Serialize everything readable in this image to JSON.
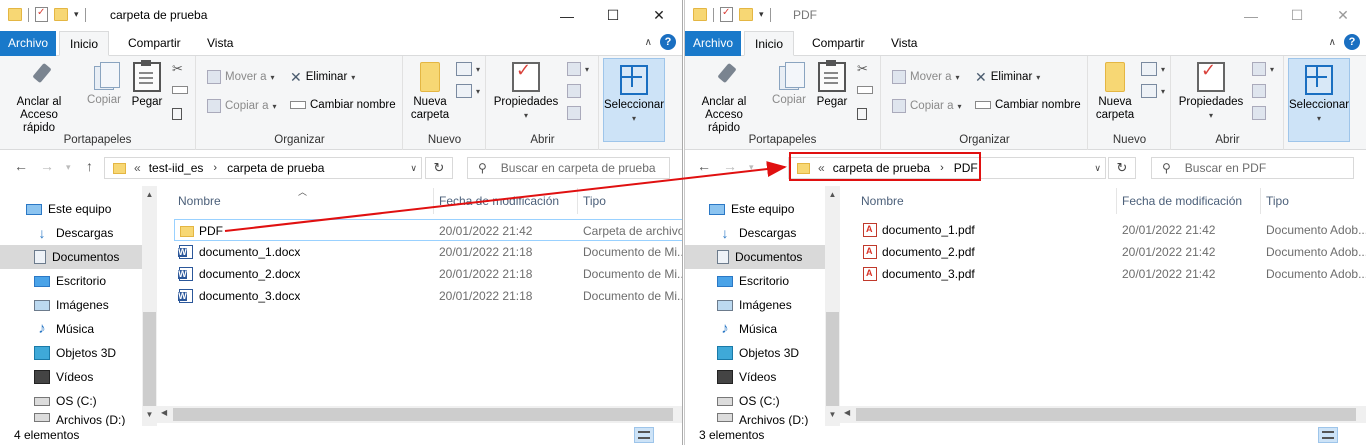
{
  "windows": [
    {
      "id": "left",
      "title": "carpeta de prueba",
      "tabs": {
        "file": "Archivo",
        "home": "Inicio",
        "share": "Compartir",
        "view": "Vista"
      },
      "ribbon": {
        "clipboard": {
          "label": "Portapapeles",
          "pin": "Anclar al\nAcceso rápido",
          "copy": "Copiar",
          "paste": "Pegar"
        },
        "organize": {
          "label": "Organizar",
          "move": "Mover a",
          "copy_to": "Copiar a",
          "delete": "Eliminar",
          "rename": "Cambiar nombre"
        },
        "new": {
          "label": "Nuevo",
          "new_folder": "Nueva\ncarpeta"
        },
        "open": {
          "label": "Abrir",
          "properties": "Propiedades"
        },
        "select": {
          "label": "Seleccionar"
        }
      },
      "address": {
        "overflow": "«",
        "crumbs": [
          "test-iid_es",
          "carpeta de prueba"
        ]
      },
      "search_placeholder": "Buscar en carpeta de prueba",
      "nav": [
        "Este equipo",
        "Descargas",
        "Documentos",
        "Escritorio",
        "Imágenes",
        "Música",
        "Objetos 3D",
        "Vídeos",
        "OS (C:)",
        "Archivos (D:)"
      ],
      "nav_selected": "Documentos",
      "columns": {
        "name": "Nombre",
        "date": "Fecha de modificación",
        "type": "Tipo"
      },
      "files": [
        {
          "name": "PDF",
          "date": "20/01/2022 21:42",
          "type": "Carpeta de archivos",
          "icon": "folder-icon"
        },
        {
          "name": "documento_1.docx",
          "date": "20/01/2022 21:18",
          "type": "Documento de Mi...",
          "icon": "word-doc-icon"
        },
        {
          "name": "documento_2.docx",
          "date": "20/01/2022 21:18",
          "type": "Documento de Mi...",
          "icon": "word-doc-icon"
        },
        {
          "name": "documento_3.docx",
          "date": "20/01/2022 21:18",
          "type": "Documento de Mi...",
          "icon": "word-doc-icon"
        }
      ],
      "status": "4 elementos"
    },
    {
      "id": "right",
      "title": "PDF",
      "tabs": {
        "file": "Archivo",
        "home": "Inicio",
        "share": "Compartir",
        "view": "Vista"
      },
      "ribbon": {
        "clipboard": {
          "label": "Portapapeles",
          "pin": "Anclar al\nAcceso rápido",
          "copy": "Copiar",
          "paste": "Pegar"
        },
        "organize": {
          "label": "Organizar",
          "move": "Mover a",
          "copy_to": "Copiar a",
          "delete": "Eliminar",
          "rename": "Cambiar nombre"
        },
        "new": {
          "label": "Nuevo",
          "new_folder": "Nueva\ncarpeta"
        },
        "open": {
          "label": "Abrir",
          "properties": "Propiedades"
        },
        "select": {
          "label": "Seleccionar"
        }
      },
      "address": {
        "overflow": "«",
        "crumbs": [
          "carpeta de prueba",
          "PDF"
        ]
      },
      "search_placeholder": "Buscar en PDF",
      "nav": [
        "Este equipo",
        "Descargas",
        "Documentos",
        "Escritorio",
        "Imágenes",
        "Música",
        "Objetos 3D",
        "Vídeos",
        "OS (C:)",
        "Archivos (D:)"
      ],
      "nav_selected": "Documentos",
      "columns": {
        "name": "Nombre",
        "date": "Fecha de modificación",
        "type": "Tipo"
      },
      "files": [
        {
          "name": "documento_1.pdf",
          "date": "20/01/2022 21:42",
          "type": "Documento Adob...",
          "icon": "pdf-icon"
        },
        {
          "name": "documento_2.pdf",
          "date": "20/01/2022 21:42",
          "type": "Documento Adob...",
          "icon": "pdf-icon"
        },
        {
          "name": "documento_3.pdf",
          "date": "20/01/2022 21:42",
          "type": "Documento Adob...",
          "icon": "pdf-icon"
        }
      ],
      "status": "3 elementos"
    }
  ],
  "annotation": {
    "color": "#e01010"
  },
  "colors": {
    "file_tab": "#1979ca",
    "ribbon_bg": "#f5f6f7",
    "selected_nav": "#d9d9d9",
    "highlight_row": "#99d1ff"
  }
}
